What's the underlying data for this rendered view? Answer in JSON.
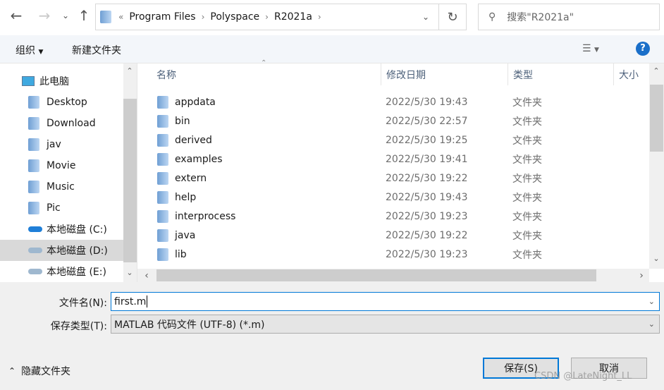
{
  "address": {
    "overflow": "«",
    "crumbs": [
      "Program Files",
      "Polyspace",
      "R2021a"
    ]
  },
  "search": {
    "placeholder": "搜索\"R2021a\""
  },
  "toolbar": {
    "organize": "组织",
    "new_folder": "新建文件夹"
  },
  "nav": [
    {
      "label": "此电脑",
      "icon": "computer-icon"
    },
    {
      "label": "Desktop",
      "icon": "desktop-folder-icon"
    },
    {
      "label": "Download",
      "icon": "download-folder-icon"
    },
    {
      "label": "jav",
      "icon": "folder-icon"
    },
    {
      "label": "Movie",
      "icon": "video-folder-icon"
    },
    {
      "label": "Music",
      "icon": "music-folder-icon"
    },
    {
      "label": "Pic",
      "icon": "picture-folder-icon"
    },
    {
      "label": "本地磁盘 (C:)",
      "icon": "drive-icon"
    },
    {
      "label": "本地磁盘 (D:)",
      "icon": "drive-icon",
      "selected": true
    },
    {
      "label": "本地磁盘 (E:)",
      "icon": "drive-icon"
    }
  ],
  "columns": {
    "name": "名称",
    "date": "修改日期",
    "type": "类型",
    "size": "大小"
  },
  "files": [
    {
      "name": "appdata",
      "date": "2022/5/30 19:43",
      "type": "文件夹"
    },
    {
      "name": "bin",
      "date": "2022/5/30 22:57",
      "type": "文件夹"
    },
    {
      "name": "derived",
      "date": "2022/5/30 19:25",
      "type": "文件夹"
    },
    {
      "name": "examples",
      "date": "2022/5/30 19:41",
      "type": "文件夹"
    },
    {
      "name": "extern",
      "date": "2022/5/30 19:22",
      "type": "文件夹"
    },
    {
      "name": "help",
      "date": "2022/5/30 19:43",
      "type": "文件夹"
    },
    {
      "name": "interprocess",
      "date": "2022/5/30 19:23",
      "type": "文件夹"
    },
    {
      "name": "java",
      "date": "2022/5/30 19:22",
      "type": "文件夹"
    },
    {
      "name": "lib",
      "date": "2022/5/30 19:23",
      "type": "文件夹"
    }
  ],
  "form": {
    "filename_label": "文件名(N):",
    "filename": "first.m",
    "filetype_label": "保存类型(T):",
    "filetype": "MATLAB 代码文件 (UTF-8) (*.m)"
  },
  "footer": {
    "hide_folders": "隐藏文件夹",
    "save": "保存(S)",
    "cancel": "取消",
    "watermark": "CSDN @LateNight_LL"
  }
}
